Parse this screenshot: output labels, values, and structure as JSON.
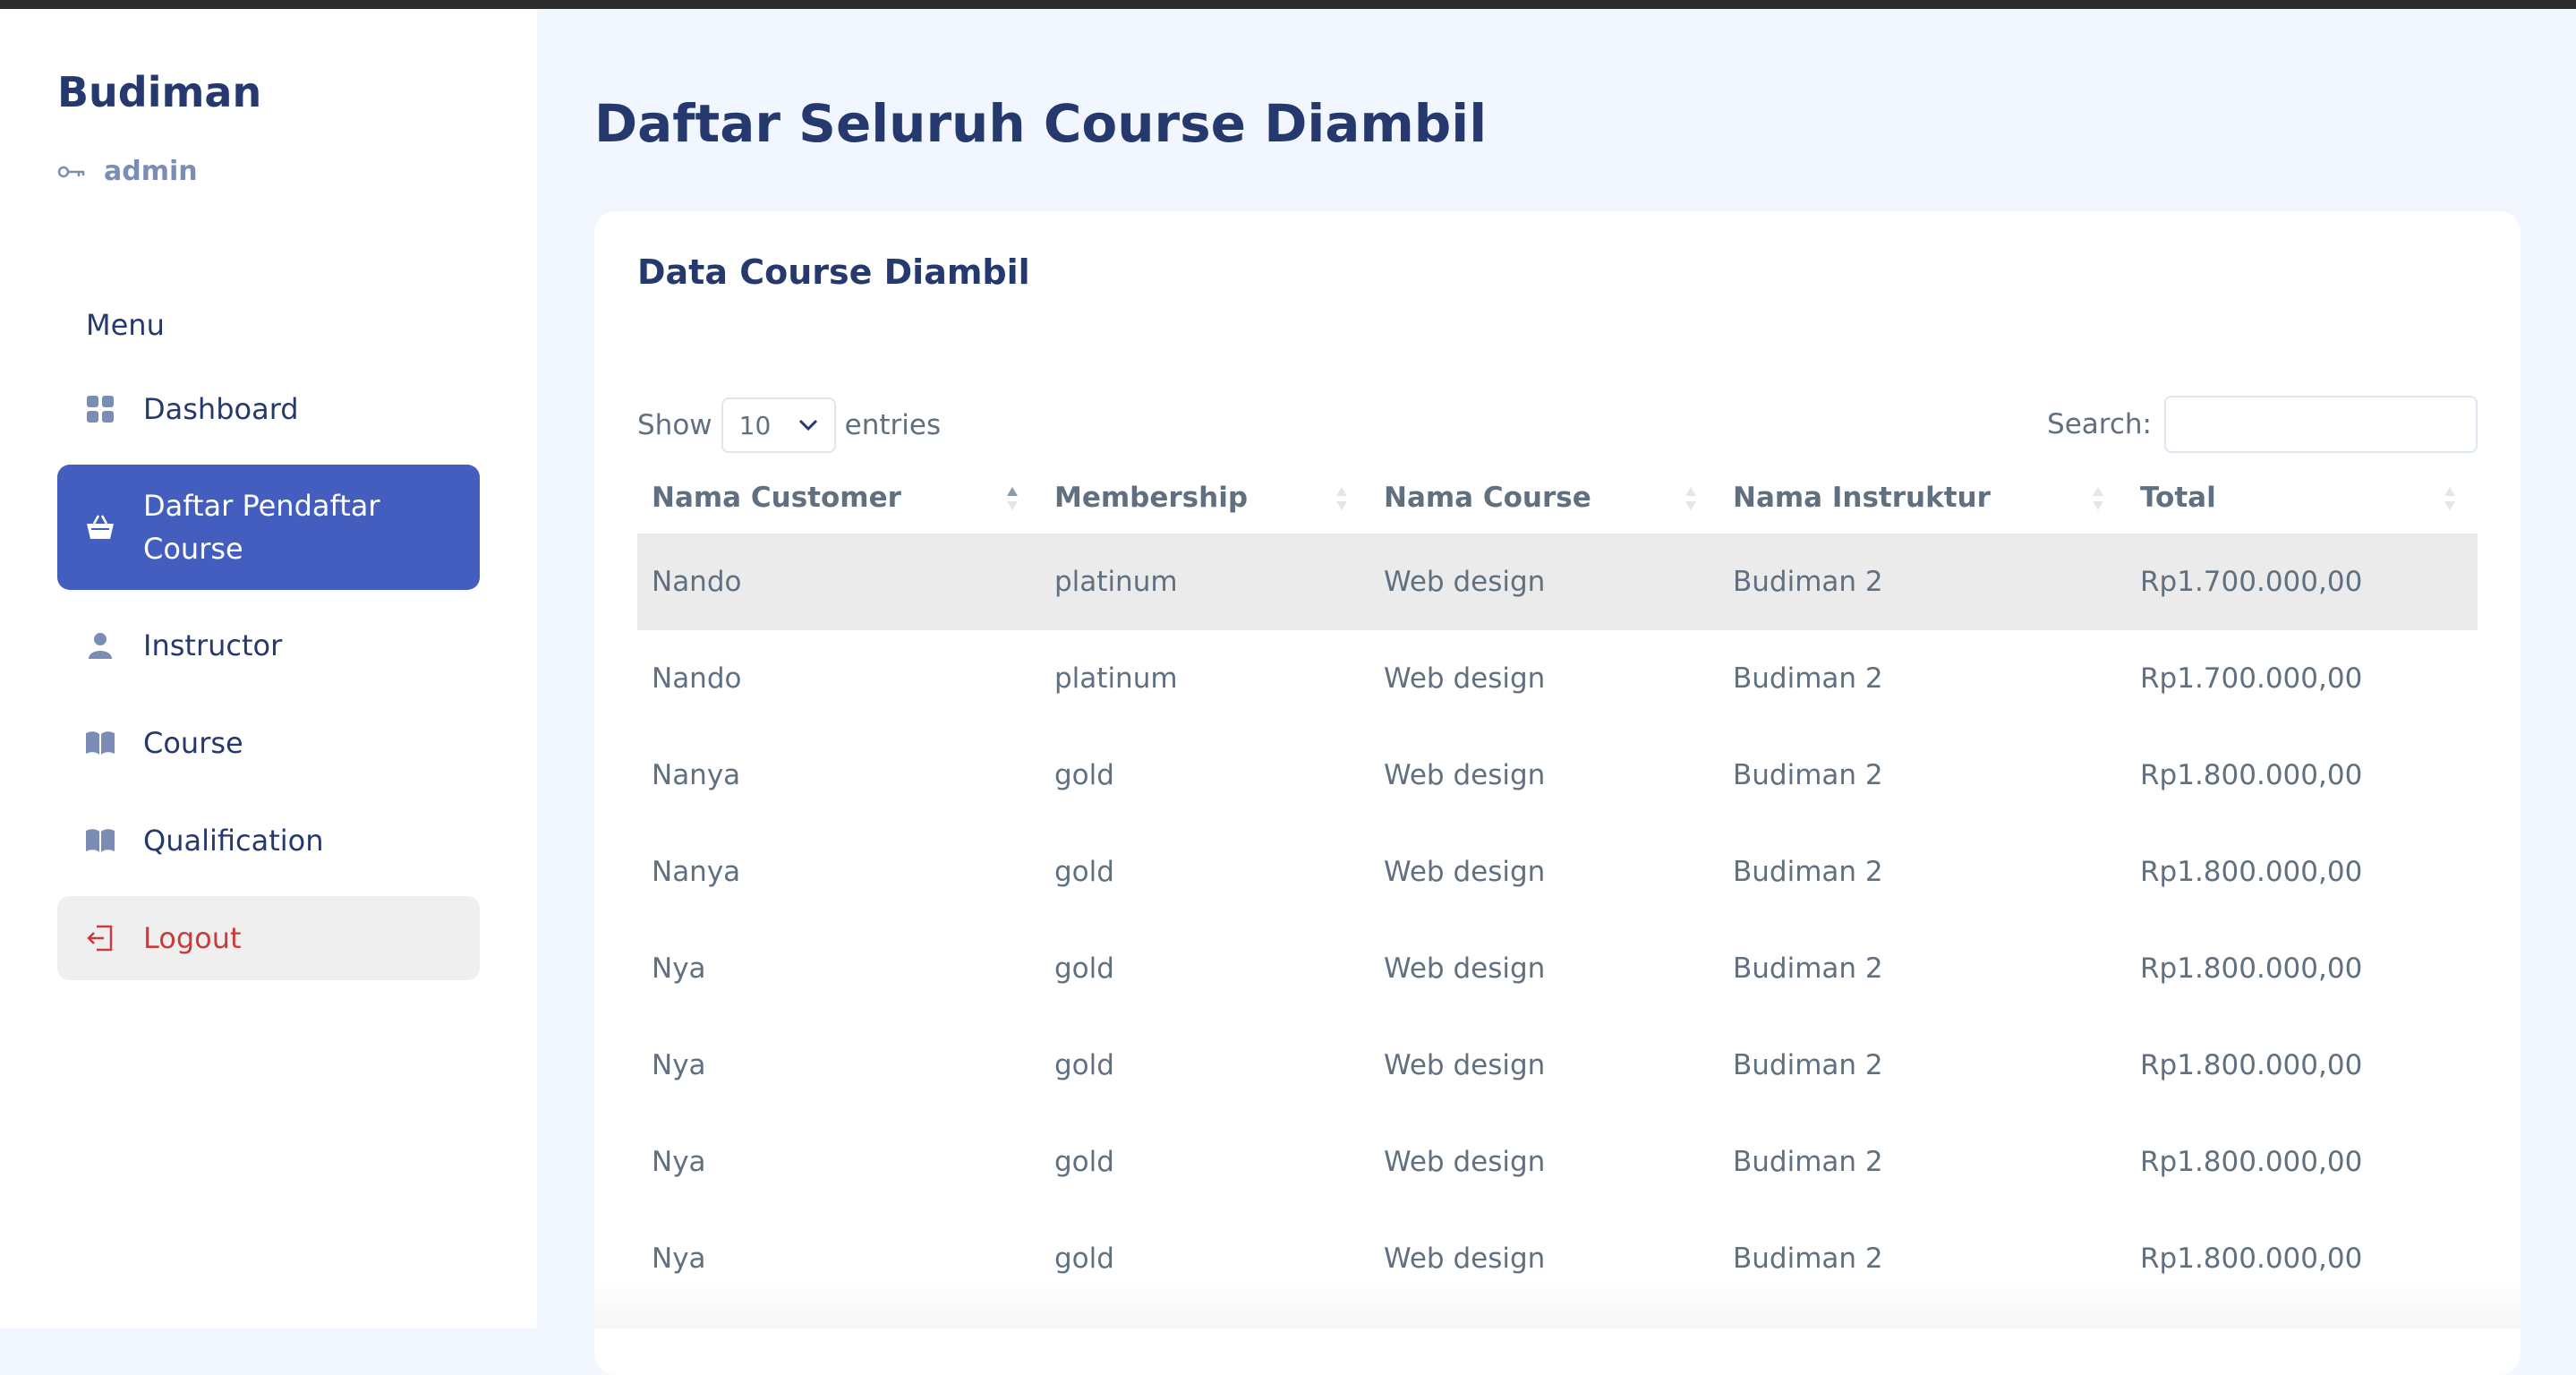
{
  "sidebar": {
    "brand": "Budiman",
    "role": "admin",
    "menu_title": "Menu",
    "items": [
      {
        "label": "Dashboard",
        "icon": "grid-icon"
      },
      {
        "label": "Daftar Pendaftar Course",
        "icon": "basket-icon",
        "active": true
      },
      {
        "label": "Instructor",
        "icon": "person-icon"
      },
      {
        "label": "Course",
        "icon": "book-icon"
      },
      {
        "label": "Qualification",
        "icon": "book-icon"
      },
      {
        "label": "Logout",
        "icon": "logout-icon"
      }
    ]
  },
  "main": {
    "title": "Daftar Seluruh Course Diambil",
    "card_title": "Data Course Diambil",
    "show_label": "Show",
    "entries_value": "10",
    "entries_label": "entries",
    "search_label": "Search:",
    "columns": [
      "Nama Customer",
      "Membership",
      "Nama Course",
      "Nama Instruktur",
      "Total"
    ],
    "rows": [
      [
        "Nando",
        "platinum",
        "Web design",
        "Budiman 2",
        "Rp1.700.000,00"
      ],
      [
        "Nando",
        "platinum",
        "Web design",
        "Budiman 2",
        "Rp1.700.000,00"
      ],
      [
        "Nanya",
        "gold",
        "Web design",
        "Budiman 2",
        "Rp1.800.000,00"
      ],
      [
        "Nanya",
        "gold",
        "Web design",
        "Budiman 2",
        "Rp1.800.000,00"
      ],
      [
        "Nya",
        "gold",
        "Web design",
        "Budiman 2",
        "Rp1.800.000,00"
      ],
      [
        "Nya",
        "gold",
        "Web design",
        "Budiman 2",
        "Rp1.800.000,00"
      ],
      [
        "Nya",
        "gold",
        "Web design",
        "Budiman 2",
        "Rp1.800.000,00"
      ],
      [
        "Nya",
        "gold",
        "Web design",
        "Budiman 2",
        "Rp1.800.000,00"
      ]
    ]
  },
  "colors": {
    "accent": "#435ebe",
    "text_dark": "#25396f",
    "text_muted": "#607080",
    "logout": "#cc3b3b"
  }
}
